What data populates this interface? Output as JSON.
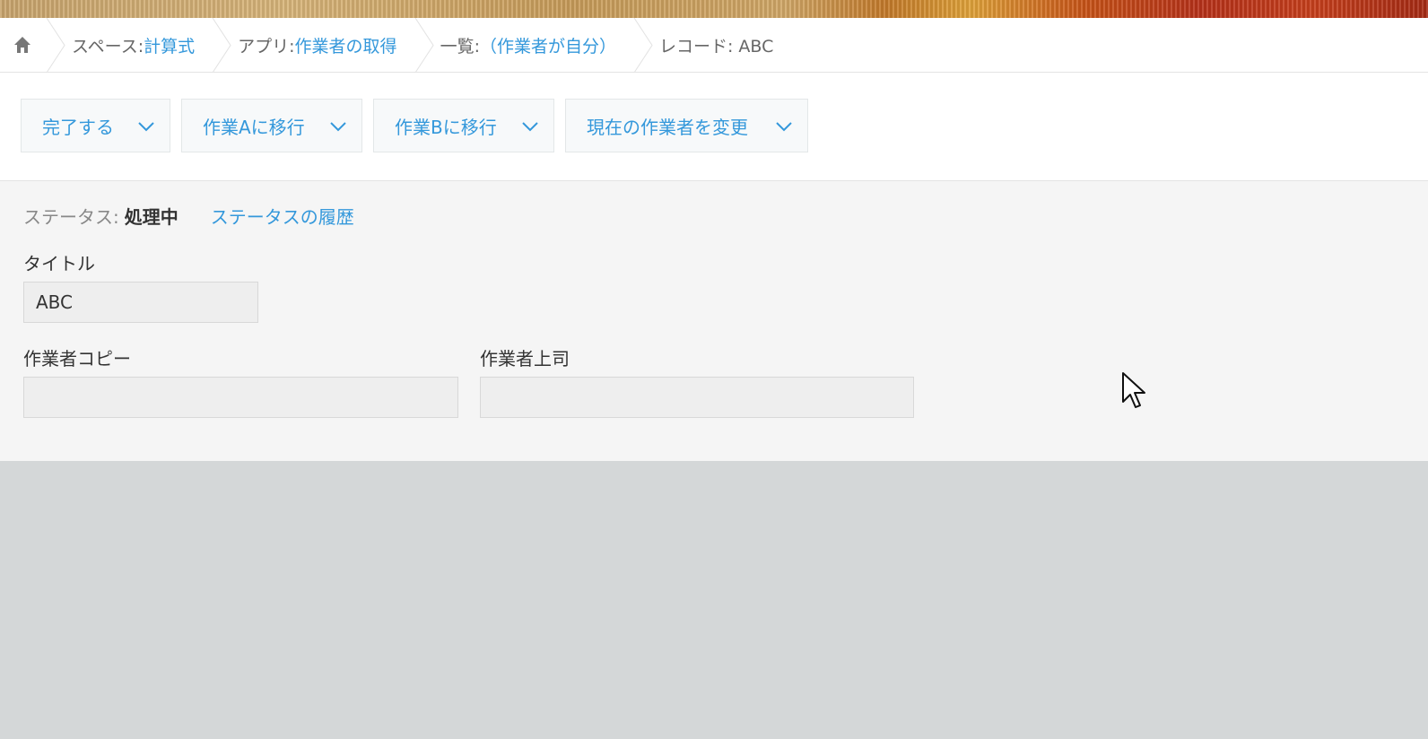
{
  "breadcrumb": {
    "home_icon": "home-icon",
    "space_prefix": "スペース: ",
    "space_name": "計算式",
    "app_prefix": "アプリ: ",
    "app_name": "作業者の取得",
    "list_prefix": "一覧: ",
    "list_name": "（作業者が自分）",
    "record_label": "レコード: ABC"
  },
  "actions": [
    {
      "label": "完了する",
      "icon": "chevron-down-icon"
    },
    {
      "label": "作業Aに移行",
      "icon": "chevron-down-icon"
    },
    {
      "label": "作業Bに移行",
      "icon": "chevron-down-icon"
    },
    {
      "label": "現在の作業者を変更",
      "icon": "chevron-down-icon"
    }
  ],
  "status": {
    "label": "ステータス: ",
    "value": "処理中",
    "history_link": "ステータスの履歴"
  },
  "fields": {
    "title": {
      "label": "タイトル",
      "value": "ABC"
    },
    "worker_copy": {
      "label": "作業者コピー",
      "value": ""
    },
    "worker_supervisor": {
      "label": "作業者上司",
      "value": ""
    }
  },
  "colors": {
    "link": "#3498db",
    "text": "#333333",
    "muted": "#888888",
    "panel": "#f5f5f5",
    "backdrop": "#d4d7d8"
  }
}
